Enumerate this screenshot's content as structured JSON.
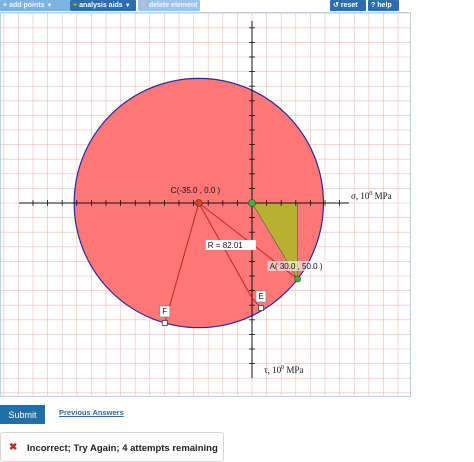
{
  "toolbar": {
    "add_points": "add points",
    "analysis_aids": "analysis aids",
    "delete_element": "delete element",
    "reset": "reset",
    "help": "help"
  },
  "graph": {
    "center_label": "C(-35.0 , 0.0 )",
    "point_a_label": "A( 30.0 , 50.0 )",
    "radius_label": "R = 82.01",
    "point_e_label": "E",
    "point_f_label": "F",
    "sigma_axis_label": "σ, 10",
    "sigma_axis_exp": "0",
    "sigma_axis_unit": " MPa",
    "tau_axis_label": "τ, 10",
    "tau_axis_exp": "0",
    "tau_axis_unit": " MPa",
    "colors": {
      "circle_fill": "#ff6b6b",
      "circle_stroke": "#2a2aa0",
      "triangle_fill": "#b8b030",
      "grid": "#f4b8b8",
      "point_c": "#e04020",
      "point_green": "#3cb43c"
    }
  },
  "actions": {
    "submit": "Submit",
    "previous_answers": "Previous Answers"
  },
  "feedback": {
    "message": "Incorrect; Try Again; 4 attempts remaining"
  }
}
